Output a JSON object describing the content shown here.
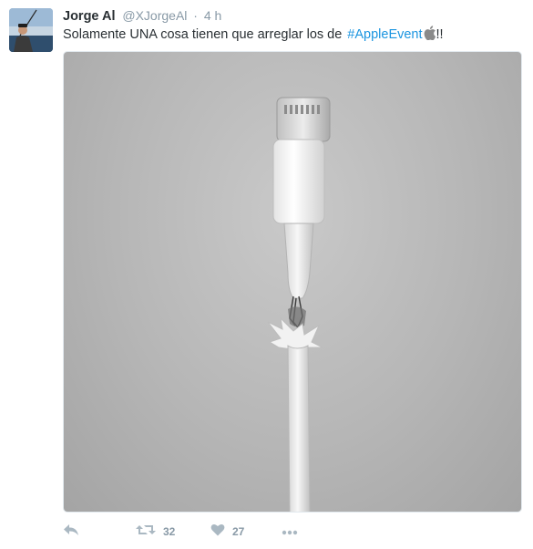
{
  "tweet": {
    "fullname": "Jorge Al",
    "screen_name": "@XJorgeAl",
    "separator": "·",
    "time": "4 h",
    "text": "Solamente UNA cosa tienen que arreglar los de",
    "hashtag": "#AppleEvent",
    "text_suffix": "!!",
    "emoji_icon": "apple-logo-icon"
  },
  "actions": {
    "reply_icon": "reply-icon",
    "retweet_icon": "retweet-icon",
    "retweet_count": "32",
    "like_icon": "heart-icon",
    "like_count": "27",
    "more_icon": "more-icon"
  },
  "colors": {
    "hashtag": "#1b95e0",
    "muted": "#8899a6",
    "text": "#292f33"
  }
}
